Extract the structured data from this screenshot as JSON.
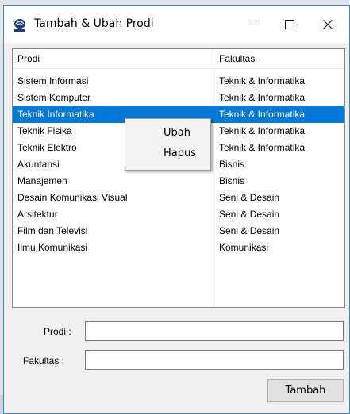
{
  "window": {
    "title": "Tambah & Ubah Prodi",
    "icon": "university-logo-icon",
    "controls": {
      "minimize": "—",
      "maximize": "☐",
      "close": "✕"
    }
  },
  "list": {
    "columns": [
      "Prodi",
      "Fakultas"
    ],
    "rows": [
      {
        "prodi": "Sistem Informasi",
        "fakultas": "Teknik & Informatika"
      },
      {
        "prodi": "Sistem Komputer",
        "fakultas": "Teknik & Informatika"
      },
      {
        "prodi": "Teknik Informatika",
        "fakultas": "Teknik & Informatika",
        "selected": true
      },
      {
        "prodi": "Teknik Fisika",
        "fakultas": "Teknik & Informatika"
      },
      {
        "prodi": "Teknik Elektro",
        "fakultas": "Teknik & Informatika"
      },
      {
        "prodi": "Akuntansi",
        "fakultas": "Bisnis"
      },
      {
        "prodi": "Manajemen",
        "fakultas": "Bisnis"
      },
      {
        "prodi": "Desain Komunikasi Visual",
        "fakultas": "Seni & Desain"
      },
      {
        "prodi": "Arsitektur",
        "fakultas": "Seni & Desain"
      },
      {
        "prodi": "Film dan Televisi",
        "fakultas": "Seni & Desain"
      },
      {
        "prodi": "Ilmu Komunikasi",
        "fakultas": "Komunikasi"
      }
    ],
    "selected_color": "#0078d7"
  },
  "context_menu": {
    "items": [
      "Ubah",
      "Hapus"
    ]
  },
  "form": {
    "prodi_label": "Prodi :",
    "prodi_value": "",
    "fakultas_label": "Fakultas :",
    "fakultas_value": "",
    "submit_label": "Tambah"
  }
}
